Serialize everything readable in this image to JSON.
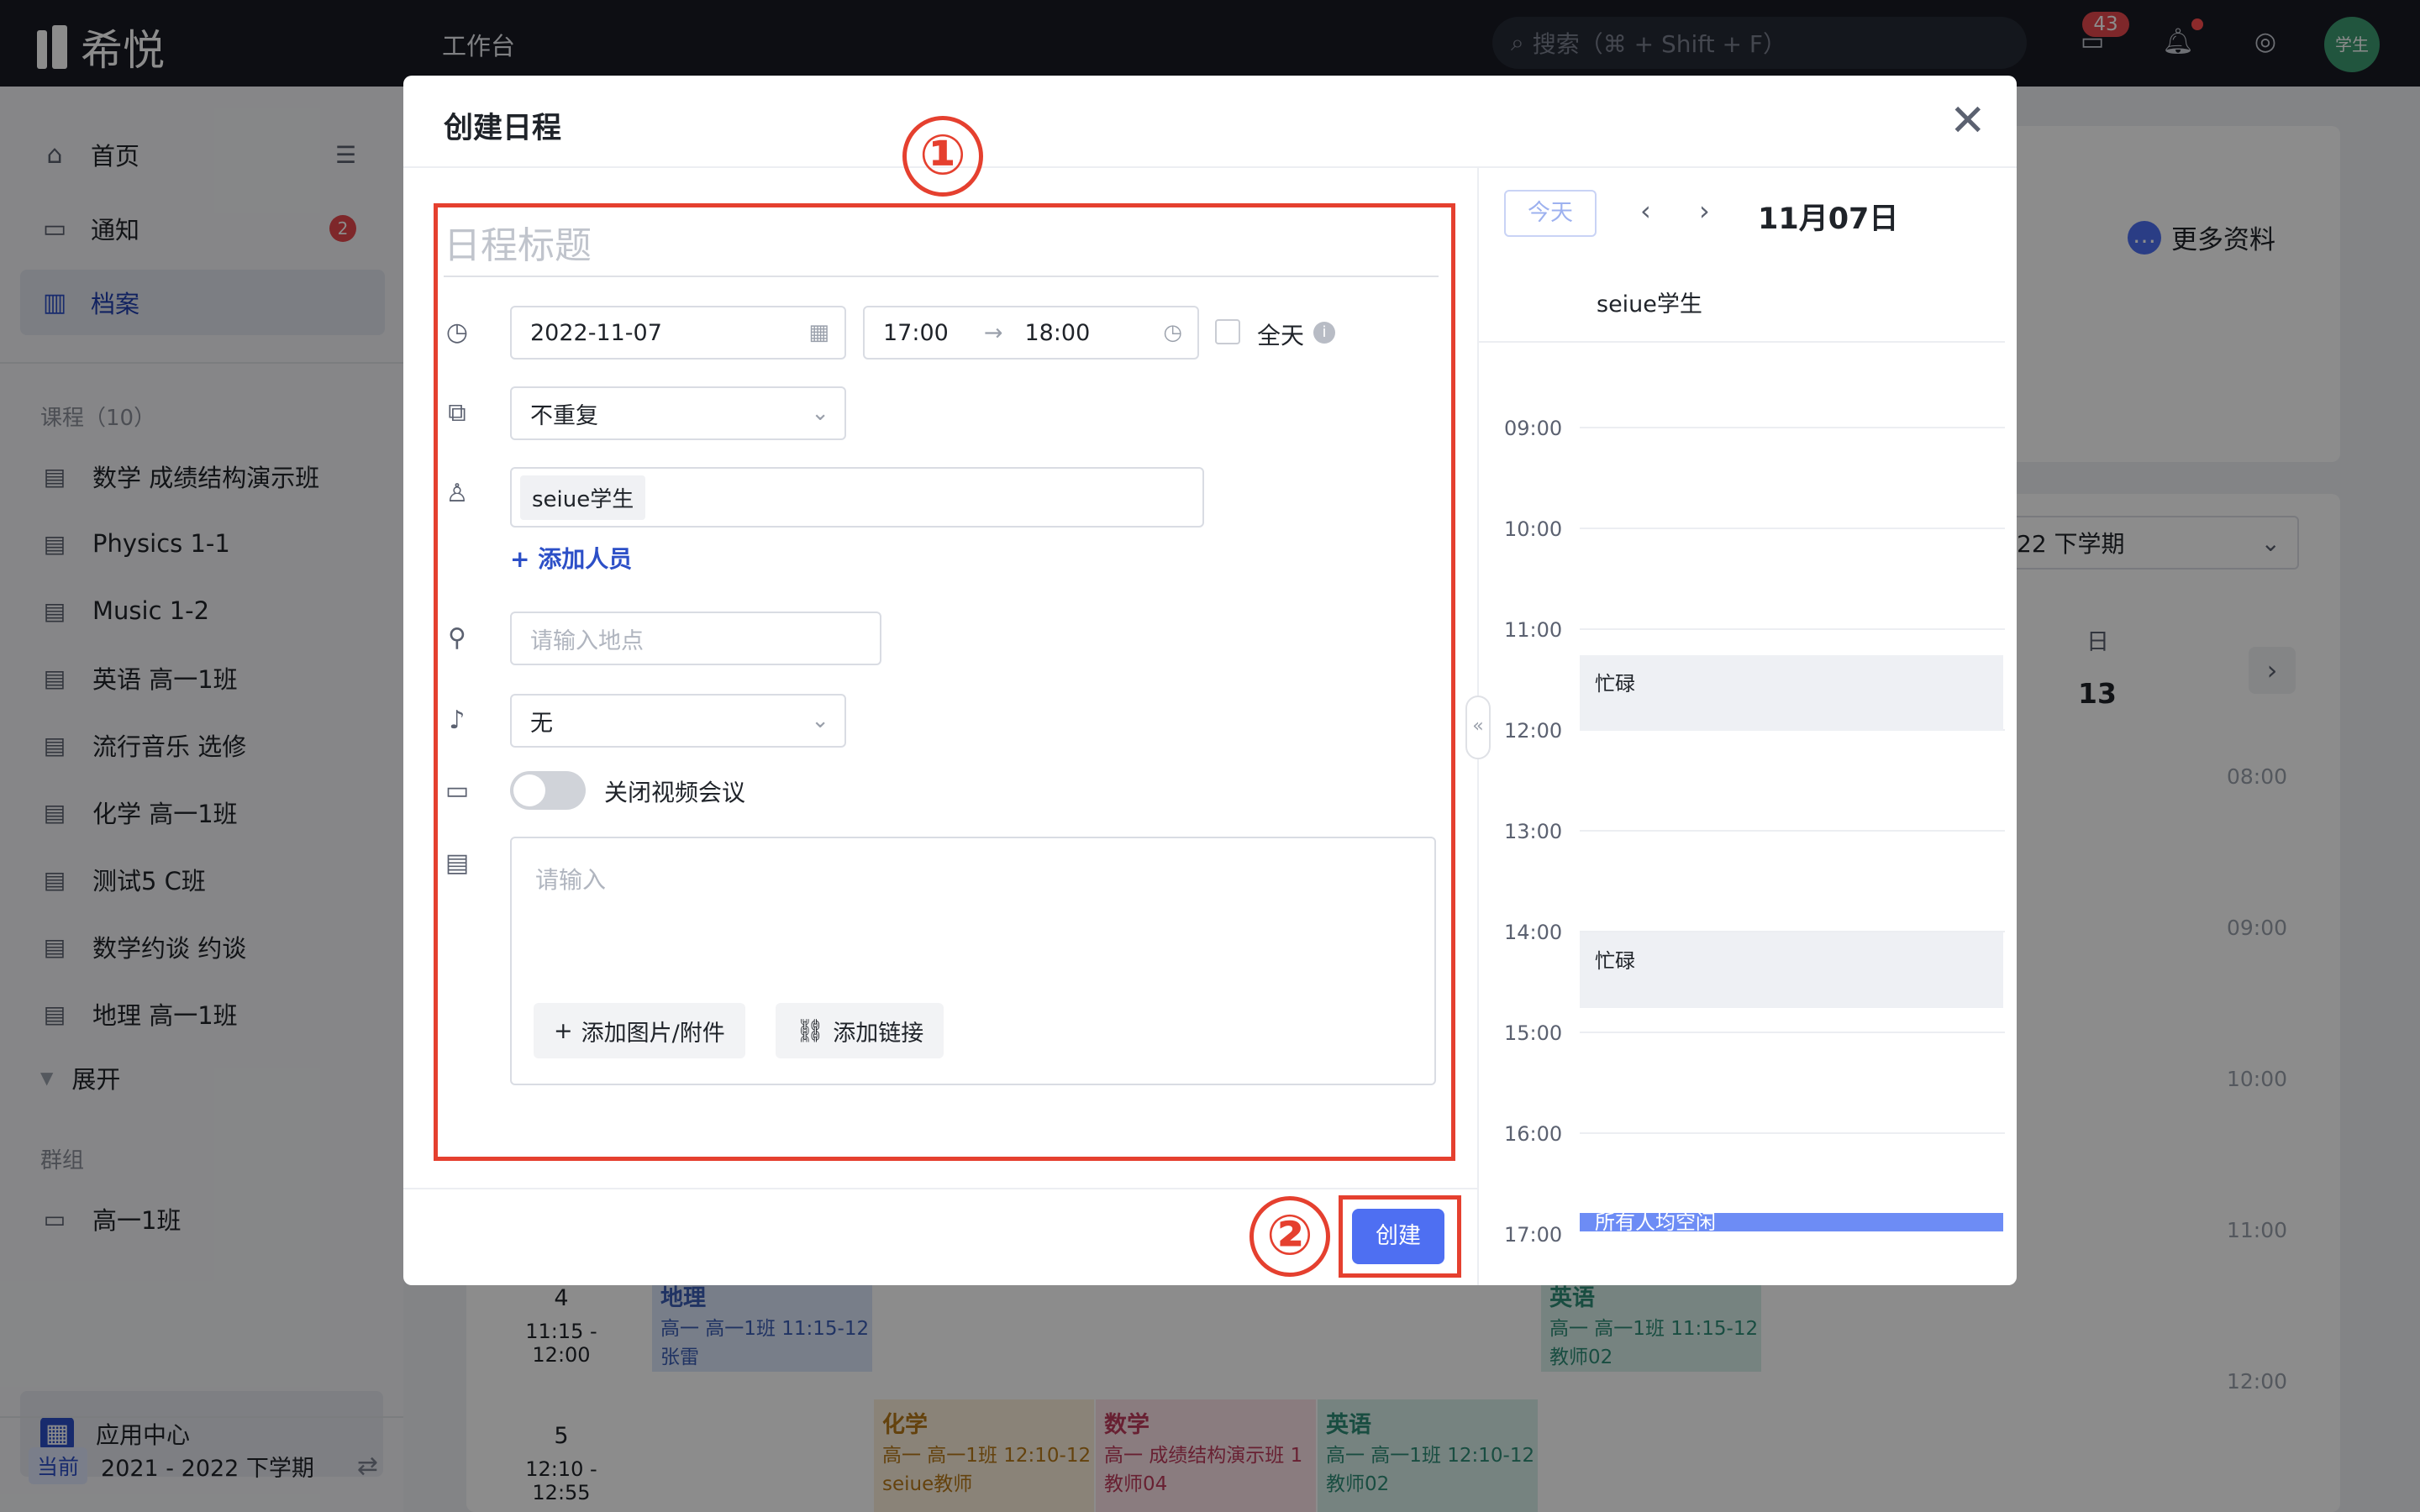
{
  "topbar": {
    "logo_text": "希悦",
    "workbench": "工作台",
    "search_placeholder": "搜索（⌘ + Shift + F）",
    "message_count": "43",
    "avatar_text": "学生"
  },
  "sidebar": {
    "nav": [
      {
        "label": "首页",
        "icon": "home-icon"
      },
      {
        "label": "通知",
        "icon": "message-icon",
        "badge": "2"
      },
      {
        "label": "档案",
        "icon": "archive-icon"
      }
    ],
    "courses_header": "课程（10）",
    "courses": [
      "数学 成绩结构演示班",
      "Physics 1-1",
      "Music 1-2",
      "英语 高一1班",
      "流行音乐 选修",
      "化学 高一1班",
      "测试5 C班",
      "数学约谈 约谈",
      "地理 高一1班"
    ],
    "expand": "展开",
    "groups_header": "群组",
    "groups": [
      "高一1班"
    ],
    "app_center": "应用中心",
    "term_tag": "当前",
    "term": "2021 - 2022 下学期"
  },
  "background": {
    "more_info": "更多资料",
    "term_select": "22 下学期",
    "day_label": "日",
    "day_num": "13",
    "hours": [
      "08:00",
      "09:00",
      "10:00",
      "11:00",
      "12:00"
    ],
    "periods": [
      {
        "num": "4",
        "time": "11:15 - 12:00"
      },
      {
        "num": "5",
        "time": "12:10 - 12:55"
      }
    ],
    "classes": [
      {
        "name": "地理",
        "line1": "高一  高一1班  11:15-12",
        "line2": "张雷"
      },
      {
        "name": "英语",
        "line1": "高一  高一1班  11:15-12",
        "line2": "教师02"
      },
      {
        "name": "化学",
        "line1": "高一  高一1班  12:10-12",
        "line2": "seiue教师"
      },
      {
        "name": "数学",
        "line1": "高一  成绩结构演示班  1",
        "line2": "教师04"
      },
      {
        "name": "英语",
        "line1": "高一  高一1班  12:10-12",
        "line2": "教师02"
      }
    ]
  },
  "modal": {
    "title": "创建日程",
    "title_placeholder": "日程标题",
    "date": "2022-11-07",
    "start_time": "17:00",
    "end_time": "18:00",
    "all_day": "全天",
    "repeat": "不重复",
    "attendee": "seiue学生",
    "add_people": "添加人员",
    "location_placeholder": "请输入地点",
    "reminder": "无",
    "video_label": "关闭视频会议",
    "desc_placeholder": "请输入",
    "add_attachment": "添加图片/附件",
    "add_link": "添加链接",
    "create": "创建",
    "marker1": "①",
    "marker2": "②"
  },
  "calendar": {
    "today": "今天",
    "date": "11月07日",
    "owner": "seiue学生",
    "hours": [
      "09:00",
      "10:00",
      "11:00",
      "12:00",
      "13:00",
      "14:00",
      "15:00",
      "16:00",
      "17:00"
    ],
    "busy": [
      "忙碌",
      "忙碌"
    ],
    "event": "所有人均空闲"
  },
  "colors": {
    "accent": "#4e6ff2",
    "annotation": "#e5402f",
    "topbar": "#181b24"
  }
}
